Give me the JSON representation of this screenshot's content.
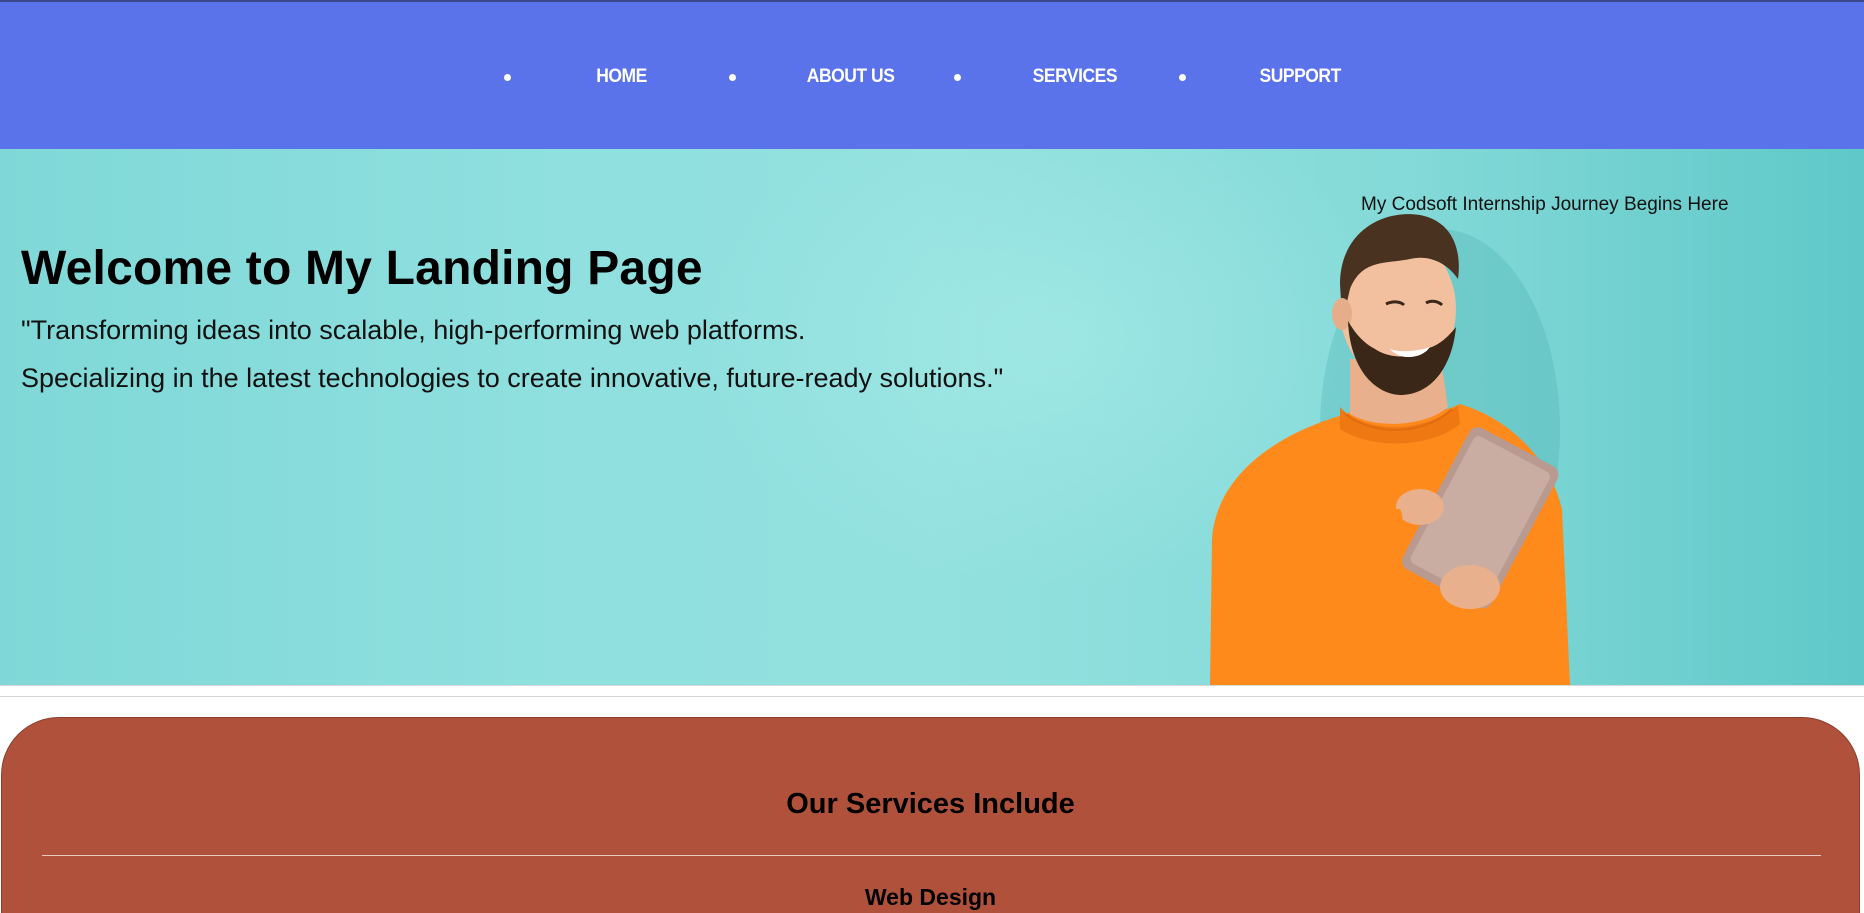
{
  "nav": {
    "items": [
      {
        "label": "HOME"
      },
      {
        "label": "ABOUT US"
      },
      {
        "label": "SERVICES"
      },
      {
        "label": "SUPPORT"
      }
    ]
  },
  "hero": {
    "tagline": "My Codsoft Internship Journey Begins Here",
    "title": "Welcome to My Landing Page",
    "subtitle_line1": "\"Transforming ideas into scalable, high-performing web platforms.",
    "subtitle_line2": "Specializing in the latest technologies to create innovative, future-ready solutions.\""
  },
  "services": {
    "title": "Our Services Include",
    "items": [
      "Web Design"
    ]
  },
  "colors": {
    "nav_bg": "#5a72ea",
    "hero_bg": "#8fe0df",
    "services_bg": "#b0513b",
    "sweater": "#ff8a1c"
  }
}
